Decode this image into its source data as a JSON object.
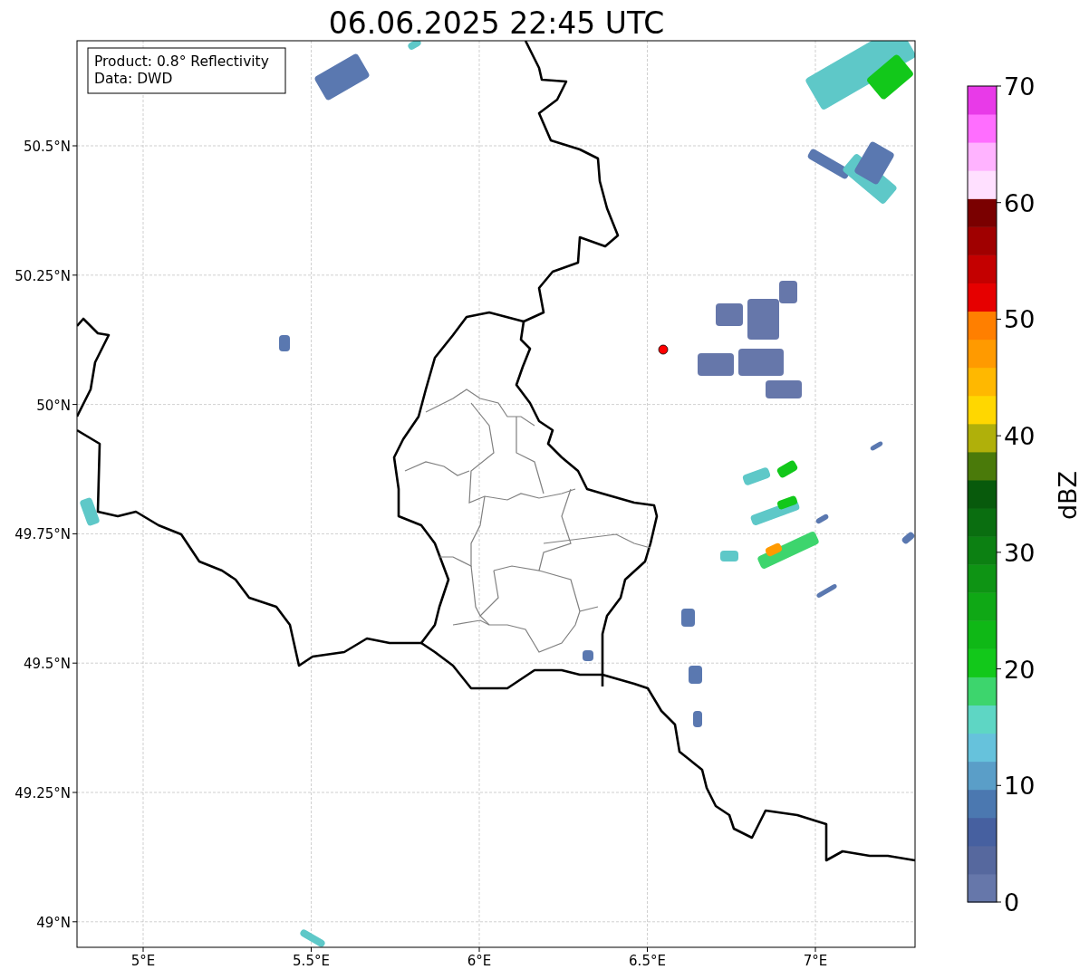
{
  "title": "06.06.2025 22:45 UTC",
  "legend": [
    "Product: 0.8° Reflectivity",
    "Data: DWD"
  ],
  "map": {
    "lat_ticks": [
      "50.5°N",
      "50.25°N",
      "50°N",
      "49.75°N",
      "49.5°N",
      "49.25°N",
      "49°N"
    ],
    "lon_ticks": [
      "5°E",
      "5.5°E",
      "6°E",
      "6.5°E",
      "7°E"
    ]
  },
  "colorbar": {
    "label": "dBZ",
    "ticks": [
      "70",
      "60",
      "50",
      "40",
      "30",
      "20",
      "10",
      "0"
    ],
    "segments": [
      {
        "color": "#6677aa"
      },
      {
        "color": "#56689e"
      },
      {
        "color": "#4660a0"
      },
      {
        "color": "#4b78b0"
      },
      {
        "color": "#5a9ec8"
      },
      {
        "color": "#66c2dc"
      },
      {
        "color": "#5ed6c4"
      },
      {
        "color": "#3dd56d"
      },
      {
        "color": "#12c81a"
      },
      {
        "color": "#0fb816"
      },
      {
        "color": "#0fa815"
      },
      {
        "color": "#0e9414"
      },
      {
        "color": "#0c8012"
      },
      {
        "color": "#0a6e10"
      },
      {
        "color": "#085a0c"
      },
      {
        "color": "#4a7a0a"
      },
      {
        "color": "#b0b00a"
      },
      {
        "color": "#ffd700"
      },
      {
        "color": "#ffb800"
      },
      {
        "color": "#ff9a00"
      },
      {
        "color": "#ff7f00"
      },
      {
        "color": "#e60000"
      },
      {
        "color": "#c40000"
      },
      {
        "color": "#a00000"
      },
      {
        "color": "#7a0000"
      },
      {
        "color": "#ffe0ff"
      },
      {
        "color": "#ffb3ff"
      },
      {
        "color": "#ff6eff"
      },
      {
        "color": "#e83ae8"
      }
    ]
  }
}
